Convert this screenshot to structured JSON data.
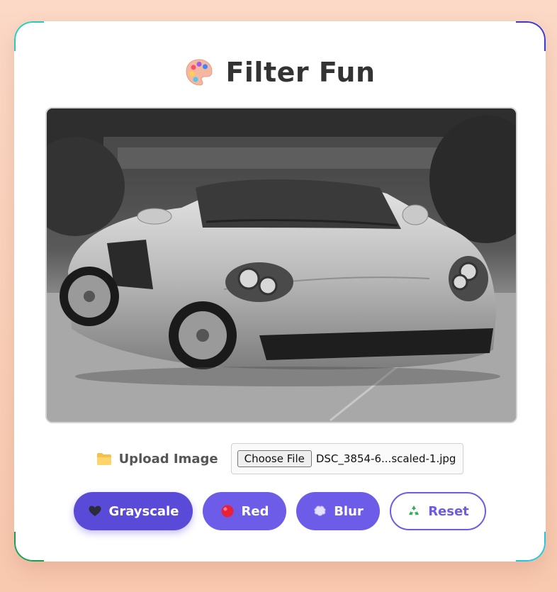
{
  "app": {
    "title": "Filter Fun",
    "title_icon": "palette-icon"
  },
  "photo": {
    "alt": "Grayscale photo of a silver convertible sports car parked on a driveway",
    "active_filter": "grayscale"
  },
  "upload": {
    "label": "Upload Image",
    "icon": "folder-icon",
    "choose_button": "Choose File",
    "file_name": "DSC_3854-6...scaled-1.jpg"
  },
  "filters": {
    "grayscale": {
      "label": "Grayscale",
      "icon": "black-heart-icon"
    },
    "red": {
      "label": "Red",
      "icon": "red-circle-icon"
    },
    "blur": {
      "label": "Blur",
      "icon": "blur-icon"
    },
    "reset": {
      "label": "Reset",
      "icon": "recycle-icon"
    }
  },
  "colors": {
    "accent": "#6c5ce7",
    "accent_active": "#5a4ad8",
    "title_text": "#333333",
    "background_top": "#fbd9c6",
    "background_bottom": "#f8c8af"
  }
}
